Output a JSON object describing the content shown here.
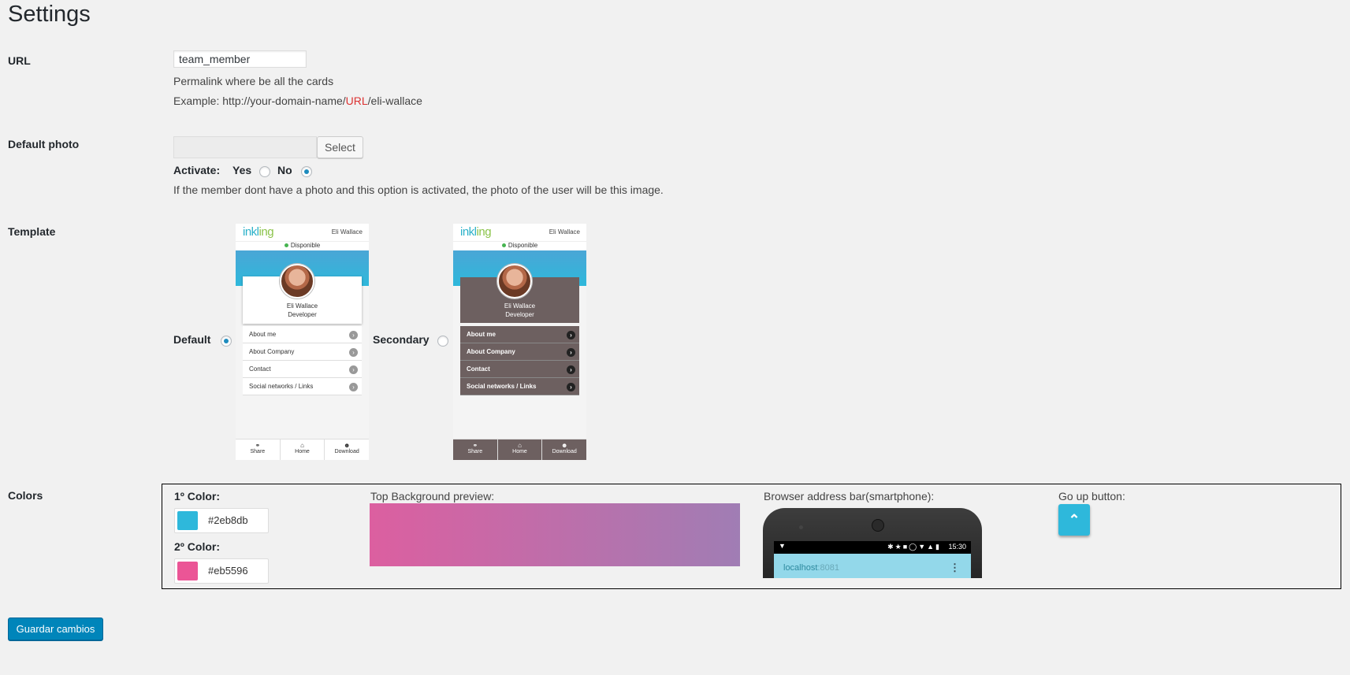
{
  "page": {
    "title": "Settings"
  },
  "url": {
    "label": "URL",
    "value": "team_member",
    "help": "Permalink where be all the cards",
    "example_prefix": "Example: http://your-domain-name/",
    "example_highlight": "URL",
    "example_suffix": "/eli-wallace"
  },
  "photo": {
    "label": "Default photo",
    "select_label": "Select",
    "activate_label": "Activate:",
    "yes_label": "Yes",
    "no_label": "No",
    "selected": "No",
    "help": "If the member dont have a photo and this option is activated, the photo of the user will be this image."
  },
  "template": {
    "label": "Template",
    "options": [
      {
        "label": "Default",
        "selected": true
      },
      {
        "label": "Secondary",
        "selected": false
      }
    ],
    "preview": {
      "logo_a": "inkl",
      "logo_b": "ing",
      "user": "Eli Wallace",
      "status": "Disponible",
      "name": "Eli Wallace",
      "role": "Developer",
      "menu": [
        "About me",
        "About Company",
        "Contact",
        "Social networks / Links"
      ],
      "footer": [
        "Share",
        "Home",
        "Download"
      ]
    }
  },
  "colors": {
    "label": "Colors",
    "color1_label": "1º Color:",
    "color1": "#2eb8db",
    "color2_label": "2º Color:",
    "color2": "#eb5596",
    "top_bg_label": "Top Background preview:",
    "gradient_start": "#dc5fa0",
    "gradient_end": "#a07db4",
    "browser_bar_label": "Browser address bar(smartphone):",
    "status_time": "15:30",
    "address_host": "localhost",
    "address_port": ":8081",
    "go_up_label": "Go up button:"
  },
  "actions": {
    "save_label": "Guardar cambios"
  }
}
